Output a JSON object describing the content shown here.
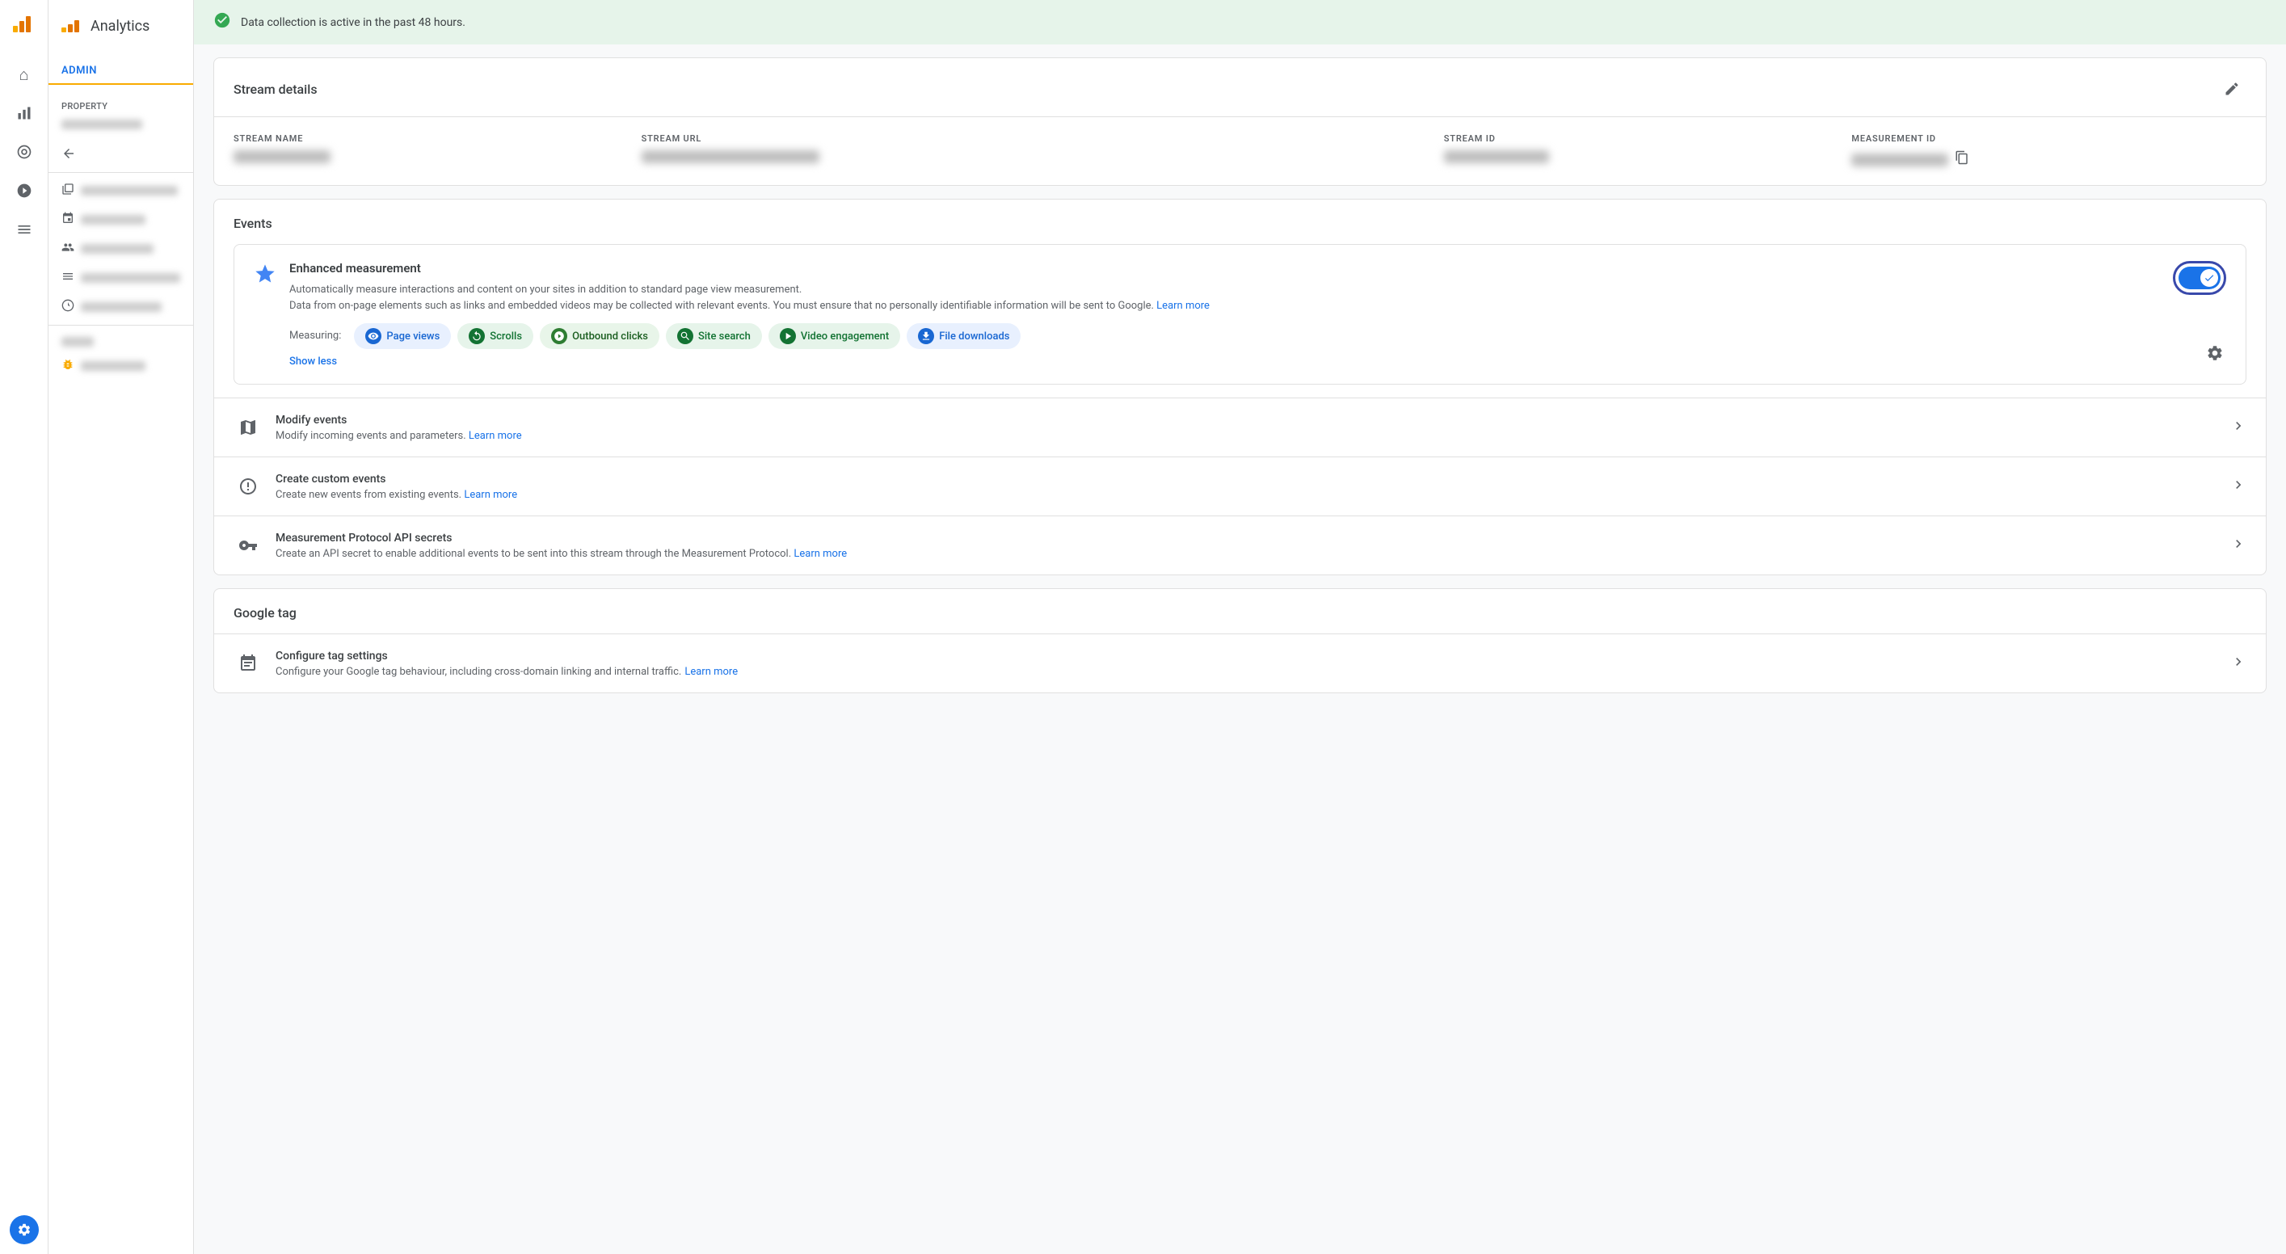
{
  "app": {
    "title": "Analytics",
    "logo_alt": "Google Analytics logo"
  },
  "sidebar": {
    "nav_items": [
      {
        "id": "home",
        "icon": "⌂",
        "label": "Home",
        "active": false
      },
      {
        "id": "reports",
        "icon": "▦",
        "label": "Reports",
        "active": false
      },
      {
        "id": "explore",
        "icon": "◎",
        "label": "Explore",
        "active": false
      },
      {
        "id": "advertising",
        "icon": "⊕",
        "label": "Advertising",
        "active": false
      },
      {
        "id": "configure",
        "icon": "☰",
        "label": "Configure",
        "active": false
      }
    ],
    "settings_icon": "⚙"
  },
  "admin": {
    "label": "ADMIN",
    "back_label": "←",
    "property_label": "Property",
    "property_value_blurred": "serha...",
    "section_pro": "PR",
    "items": [
      {
        "id": "data-streams",
        "icon": "▤",
        "label": "Data streams"
      },
      {
        "id": "events",
        "icon": "◈",
        "label": "Events"
      },
      {
        "id": "audiences",
        "icon": "👤",
        "label": "Audiences"
      },
      {
        "id": "custom-dims",
        "icon": "☰",
        "label": "Custom dimens..."
      },
      {
        "id": "custom-metrics",
        "icon": "⊘",
        "label": "Custom metrics"
      },
      {
        "id": "debug",
        "icon": "⚙",
        "label": "DebugView"
      }
    ]
  },
  "alert": {
    "icon": "✓",
    "text": "Data collection is active in the past 48 hours."
  },
  "stream_details": {
    "card_title": "Stream details",
    "edit_icon": "✏",
    "fields": [
      {
        "id": "stream-name",
        "label": "STREAM NAME",
        "value_blurred_width": 120
      },
      {
        "id": "stream-url",
        "label": "STREAM URL",
        "value_blurred_width": 200
      },
      {
        "id": "stream-id",
        "label": "STREAM ID",
        "value_blurred_width": 130
      },
      {
        "id": "measurement-id",
        "label": "MEASUREMENT ID",
        "value_blurred_width": 140
      }
    ]
  },
  "events": {
    "card_title": "Events",
    "enhanced": {
      "icon": "✦",
      "title": "Enhanced measurement",
      "description_1": "Automatically measure interactions and content on your sites in addition to standard page view measurement.",
      "description_2": "Data from on-page elements such as links and embedded videos may be collected with relevant events. You must ensure that no personally identifiable information will be sent to Google.",
      "learn_more_text": "Learn more",
      "toggle_on": true,
      "measuring_label": "Measuring:",
      "chips": [
        {
          "id": "page-views",
          "icon": "👁",
          "label": "Page views",
          "color": "blue"
        },
        {
          "id": "scrolls",
          "icon": "↻",
          "label": "Scrolls",
          "color": "teal"
        },
        {
          "id": "outbound-clicks",
          "icon": "⊕",
          "label": "Outbound clicks",
          "color": "dark-green"
        },
        {
          "id": "site-search",
          "icon": "🔍",
          "label": "Site search",
          "color": "teal"
        },
        {
          "id": "video-engagement",
          "icon": "▶",
          "label": "Video engagement",
          "color": "teal"
        },
        {
          "id": "file-downloads",
          "icon": "⬇",
          "label": "File downloads",
          "color": "blue"
        }
      ],
      "show_less_label": "Show less",
      "gear_icon": "⚙"
    },
    "items": [
      {
        "id": "modify-events",
        "icon": "☜",
        "title": "Modify events",
        "desc": "Modify incoming events and parameters.",
        "learn_more": "Learn more"
      },
      {
        "id": "create-custom-events",
        "icon": "✦",
        "title": "Create custom events",
        "desc": "Create new events from existing events.",
        "learn_more": "Learn more"
      },
      {
        "id": "measurement-protocol",
        "icon": "⊛",
        "title": "Measurement Protocol API secrets",
        "desc": "Create an API secret to enable additional events to be sent into this stream through the Measurement Protocol.",
        "learn_more": "Learn more"
      }
    ]
  },
  "google_tag": {
    "section_title": "Google tag",
    "items": [
      {
        "id": "configure-tag",
        "icon": "🏷",
        "title": "Configure tag settings",
        "desc": "Configure your Google tag behaviour, including cross-domain linking and internal traffic.",
        "learn_more": "Learn more"
      }
    ]
  }
}
